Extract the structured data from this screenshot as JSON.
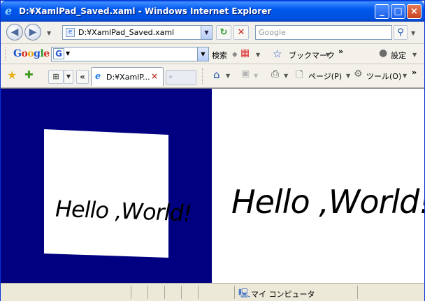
{
  "window": {
    "title": "D:¥XamlPad_Saved.xaml - Windows Internet Explorer",
    "minimize_glyph": "_",
    "maximize_glyph": "□",
    "close_glyph": "×"
  },
  "address_bar": {
    "url": "D:¥XamlPad_Saved.xaml",
    "refresh_icon": "refresh-icon",
    "stop_icon": "stop-icon"
  },
  "search": {
    "placeholder": "Google",
    "button_icon": "magnifier-icon"
  },
  "google_toolbar": {
    "logo": "Google",
    "g_button": "G",
    "search_label": "検索",
    "bookmarks_label": "ブックマーク",
    "more_glyph": "»",
    "settings_label": "設定"
  },
  "favorites_bar": {
    "tab_title": "D:¥XamlP...",
    "tab_close": "×",
    "new_tab_glyph": "»",
    "tab_list_glyph": "«",
    "page_menu": "ページ(P)",
    "tools_menu": "ツール(O)",
    "more_glyph": "»"
  },
  "page_content": {
    "left_text": "Hello ,World!",
    "right_text": "Hello ,World!",
    "left_background": "#000080",
    "right_background": "#ffffff"
  },
  "status_bar": {
    "zone": "マイ コンピュータ"
  },
  "colors": {
    "titlebar": "#0058ee",
    "accent": "#0831d9"
  }
}
